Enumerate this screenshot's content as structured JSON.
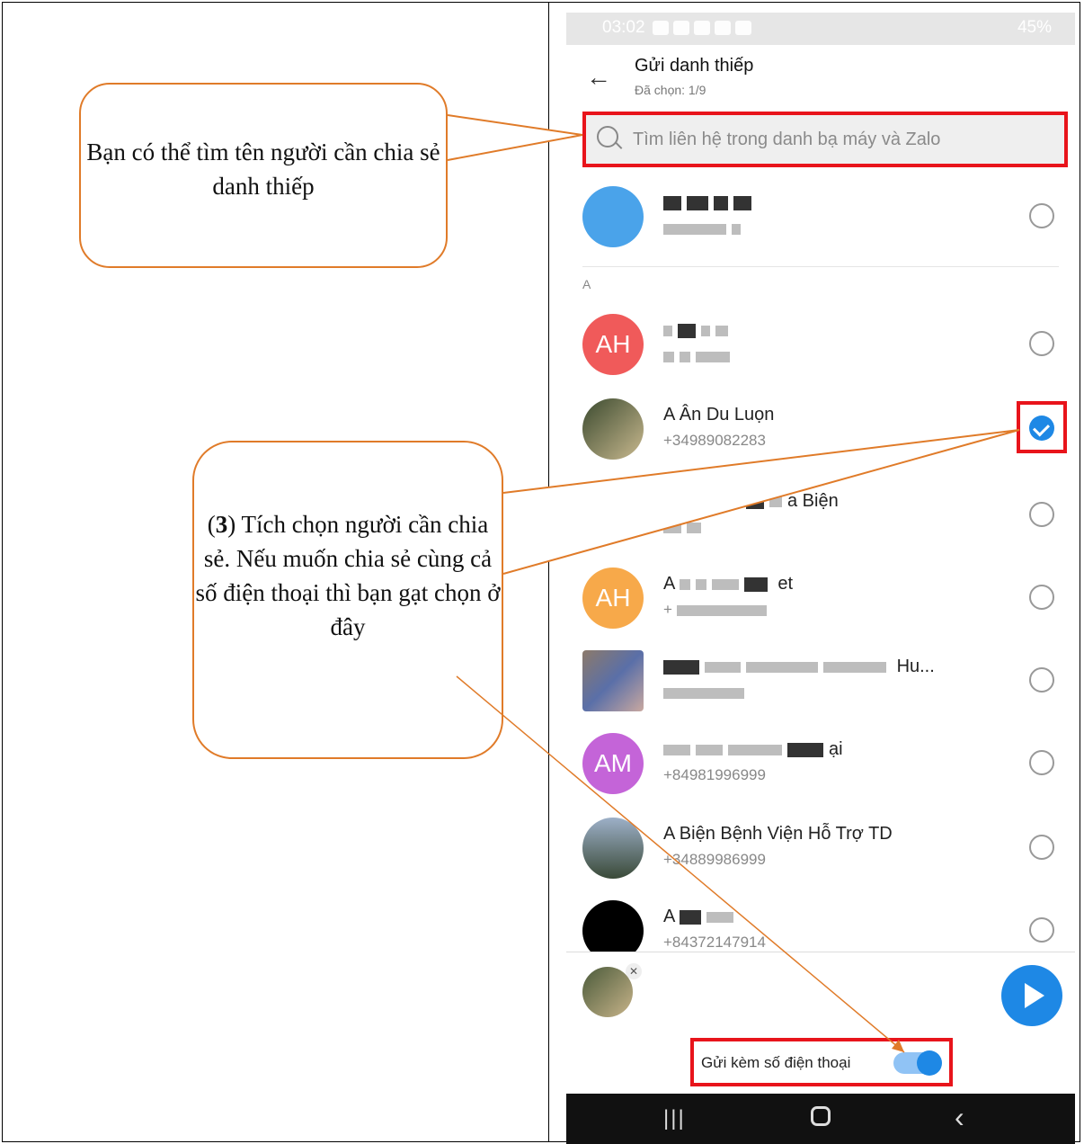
{
  "callouts": {
    "search_hint": "Bạn có thể tìm tên người cần chia sẻ danh thiếp",
    "select_hint_number": "3",
    "select_hint_text": "Tích chọn người cần chia sẻ. Nếu muốn chia sẻ cùng cả số điện thoại thì bạn gạt chọn ở đây"
  },
  "status_bar": {
    "time": "03:02",
    "battery": "45%"
  },
  "header": {
    "title": "Gửi danh thiếp",
    "subtitle": "Đã chọn: 1/9"
  },
  "search": {
    "placeholder": "Tìm liên hệ trong danh bạ máy và Zalo"
  },
  "section_label": "A",
  "contacts": [
    {
      "initials": "",
      "name": "",
      "phone": "",
      "selected": false
    },
    {
      "initials": "AH",
      "name": "",
      "phone": "",
      "selected": false
    },
    {
      "initials": "",
      "name": "A Ân Du Luọn",
      "phone": "+34989082283",
      "selected": true
    },
    {
      "initials": "",
      "name": "a Biện",
      "phone": "",
      "selected": false
    },
    {
      "initials": "AH",
      "name": "A",
      "name_suffix": "et",
      "phone": "+",
      "selected": false
    },
    {
      "initials": "",
      "name": "",
      "name_suffix": "Hu...",
      "phone": "",
      "selected": false
    },
    {
      "initials": "AM",
      "name": "",
      "name_suffix": "ại",
      "phone": "+84981996999",
      "selected": false
    },
    {
      "initials": "",
      "name": "A Biện Bệnh Viện Hỗ Trợ TD",
      "phone": "+34889986999",
      "selected": false
    },
    {
      "initials": "",
      "name": "A",
      "phone": "+84372147914",
      "selected": false
    }
  ],
  "bottom": {
    "toggle_label": "Gửi kèm số điện thoại",
    "toggle_on": true
  },
  "colors": {
    "accent": "#1e88e5",
    "highlight": "#e8141b",
    "callout_border": "#e07b29"
  }
}
